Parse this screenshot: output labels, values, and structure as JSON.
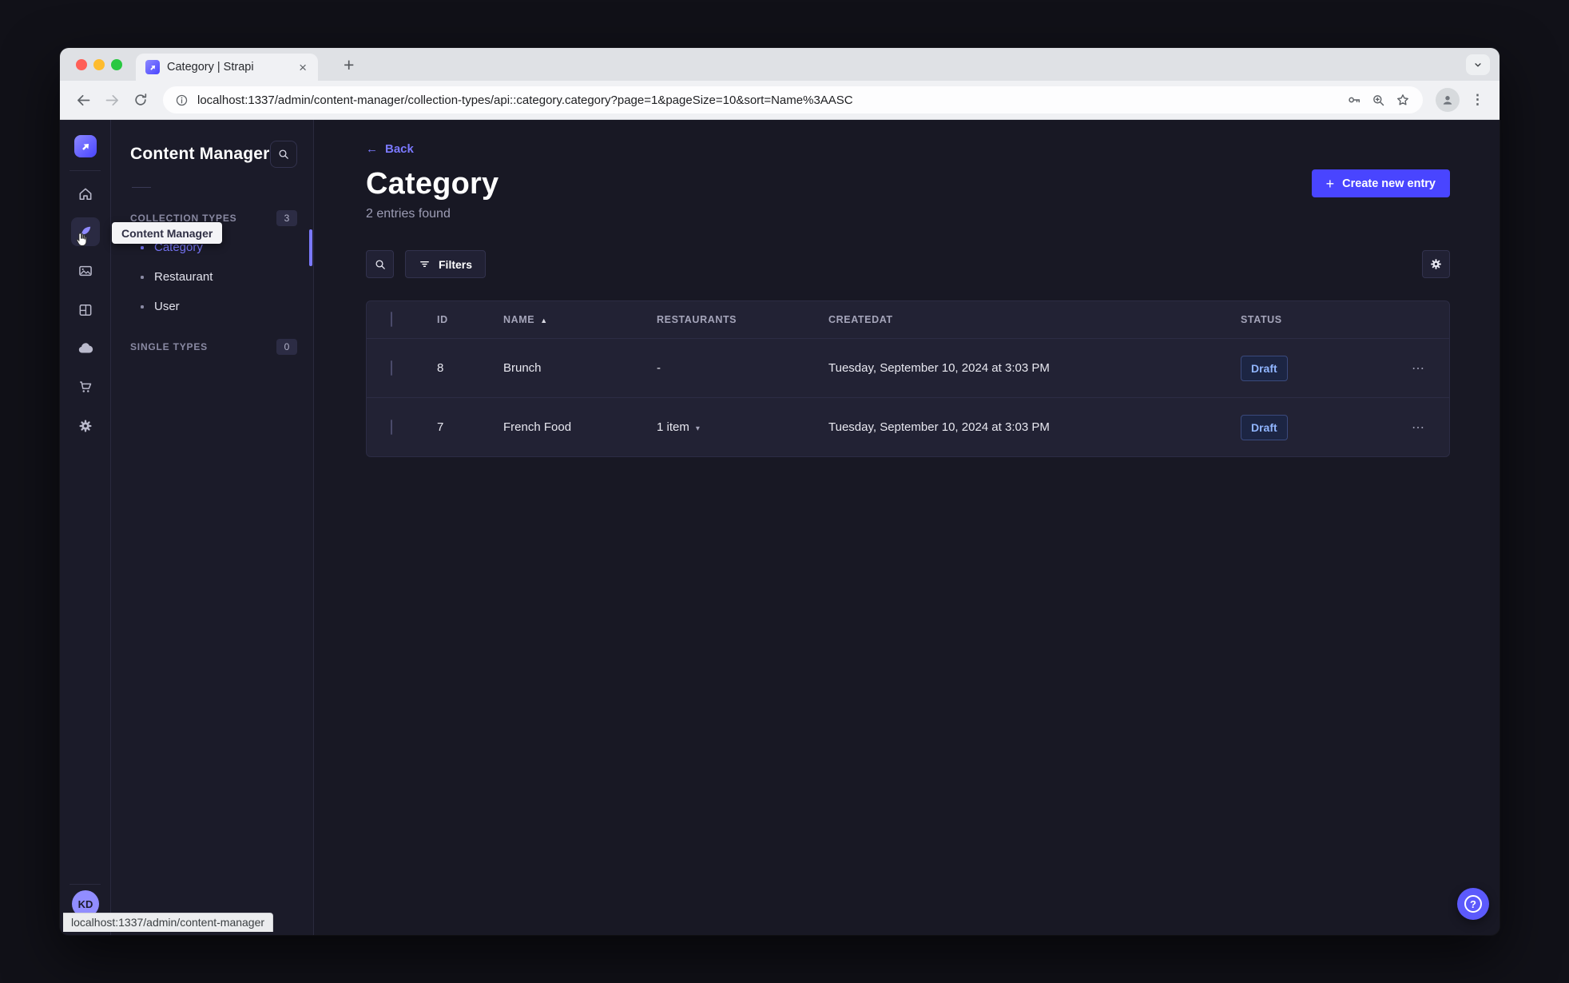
{
  "colors": {
    "accent": "#4945ff",
    "link": "#7b79ff",
    "page_bg": "#181824",
    "card_bg": "#222234",
    "status_draft_text": "#90b5ff"
  },
  "icons": {
    "plus": "+",
    "close": "×",
    "back_arrow": "←",
    "sort_asc": "▲",
    "caret_down": "▾",
    "more": "⋯",
    "kebab": "⋮",
    "question": "?"
  },
  "browser": {
    "tab_title": "Category | Strapi",
    "url": "localhost:1337/admin/content-manager/collection-types/api::category.category?page=1&pageSize=10&sort=Name%3AASC",
    "status_tooltip": "localhost:1337/admin/content-manager"
  },
  "nav": {
    "tooltip": "Content Manager",
    "avatar_initials": "KD"
  },
  "subnav": {
    "title": "Content Manager",
    "collection_types": {
      "label": "COLLECTION TYPES",
      "badge": "3",
      "items": [
        {
          "label": "Category",
          "active": true
        },
        {
          "label": "Restaurant",
          "active": false
        },
        {
          "label": "User",
          "active": false
        }
      ]
    },
    "single_types": {
      "label": "SINGLE TYPES",
      "badge": "0"
    }
  },
  "main": {
    "back_label": "Back",
    "title": "Category",
    "subtitle": "2 entries found",
    "create_button_label": "Create new entry",
    "filters_label": "Filters",
    "table": {
      "columns": {
        "id": "ID",
        "name": "NAME",
        "restaurants": "RESTAURANTS",
        "createdat": "CREATEDAT",
        "status": "STATUS"
      },
      "sort_column": "NAME",
      "sort_direction": "asc",
      "rows": [
        {
          "id": "8",
          "name": "Brunch",
          "restaurants": "-",
          "created_at": "Tuesday, September 10, 2024 at 3:03 PM",
          "status": "Draft"
        },
        {
          "id": "7",
          "name": "French Food",
          "restaurants": "1 item",
          "created_at": "Tuesday, September 10, 2024 at 3:03 PM",
          "status": "Draft"
        }
      ]
    }
  }
}
